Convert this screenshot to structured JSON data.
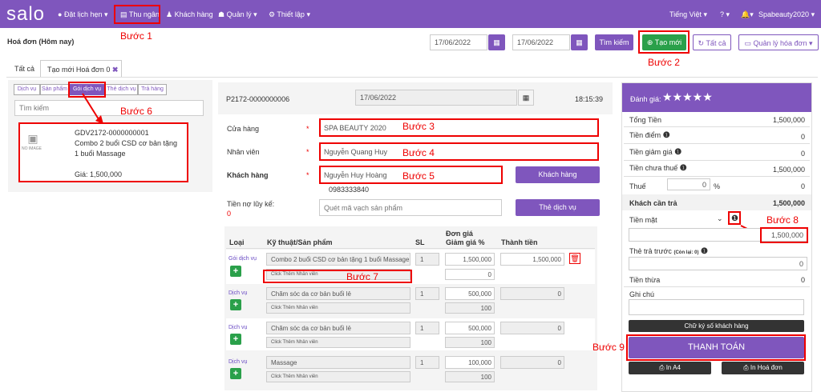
{
  "nav": {
    "logo": "salo",
    "items": [
      "Đặt lịch hẹn",
      "Thu ngân",
      "Khách hàng",
      "Quản lý",
      "Thiết lập"
    ],
    "lang": "Tiếng Việt",
    "user": "Spabeauty2020"
  },
  "header": {
    "title": "Hoá đơn (Hôm nay)",
    "date_from": "17/06/2022",
    "date_to": "17/06/2022",
    "search": "Tìm kiếm",
    "create": "Tạo mới",
    "all": "Tất cả",
    "manage": "Quản lý hóa đơn"
  },
  "tabs": {
    "all": "Tất cả",
    "new": "Tạo mới Hoá đơn 0"
  },
  "left": {
    "tabs": [
      "Dịch vụ",
      "Sản phẩm",
      "Gói dịch vụ",
      "Thẻ dịch vụ",
      "Trả hàng"
    ],
    "search_placeholder": "Tìm kiếm",
    "product": {
      "code": "GDV2172-0000000001",
      "name": "Combo 2 buổi CSD cơ bản tặng 1 buổi Massage",
      "price": "Giá: 1,500,000",
      "noimage": "NO IMAGE"
    }
  },
  "invoice": {
    "code": "P2172-0000000006",
    "date": "17/06/2022",
    "time": "18:15:39",
    "store_label": "Cửa hàng",
    "store": "SPA BEAUTY 2020",
    "staff_label": "Nhân viên",
    "staff": "Nguyễn Quang Huy",
    "customer_label": "Khách hàng",
    "customer": "Nguyễn Huy Hoàng",
    "phone": "0983333840",
    "customer_btn": "Khách hàng",
    "debt_label": "Tiền nợ lũy kế:",
    "debt": "0",
    "barcode_placeholder": "Quét mã vạch sản phẩm",
    "card_btn": "Thẻ dịch vụ",
    "cols": {
      "type": "Loại",
      "item": "Kỹ thuật/Sản phẩm",
      "qty": "SL",
      "price": "Đơn giá",
      "discount": "Giảm giá %",
      "total": "Thành tiền"
    },
    "staff_placeholder": "Click Thêm Nhân viên",
    "rows": [
      {
        "type": "Gói dịch vụ",
        "name": "Combo 2 buổi CSD cơ bản tặng 1 buổi Massage",
        "qty": "1",
        "price": "1,500,000",
        "discount": "0",
        "total": "1,500,000"
      },
      {
        "type": "Dịch vụ",
        "name": "Chăm sóc da cơ bản buổi lẻ",
        "qty": "1",
        "price": "500,000",
        "discount": "100",
        "total": "0"
      },
      {
        "type": "Dịch vụ",
        "name": "Chăm sóc da cơ bản buổi lẻ",
        "qty": "1",
        "price": "500,000",
        "discount": "100",
        "total": "0"
      },
      {
        "type": "Dịch vụ",
        "name": "Massage",
        "qty": "1",
        "price": "100,000",
        "discount": "100",
        "total": "0"
      }
    ]
  },
  "summary": {
    "rating": "Đánh giá:",
    "stars": "★★★★★",
    "total_label": "Tổng Tiền",
    "total": "1,500,000",
    "points_label": "Tiền điểm",
    "points": "0",
    "discount_label": "Tiền giảm giá",
    "discount": "0",
    "pretax_label": "Tiền chưa thuế",
    "pretax": "1,500,000",
    "tax_label": "Thuế",
    "tax_input": "0",
    "tax_unit": "%",
    "tax": "0",
    "due_label": "Khách cần trả",
    "due": "1,500,000",
    "cash_label": "Tiền mặt",
    "cash": "1,500,000",
    "prepaid_label": "Thẻ trả trước",
    "prepaid_note": "(Còn lại: 0)",
    "prepaid": "0",
    "change_label": "Tiền thừa",
    "change": "0",
    "note_label": "Ghi chú",
    "signature": "Chữ ký số khách hàng",
    "pay": "THANH TOÁN",
    "print_a4": "In A4",
    "print_invoice": "In Hoá đơn"
  },
  "steps": [
    "Bước 1",
    "Bước 2",
    "Bước 3",
    "Bước 4",
    "Bước 5",
    "Bước 6",
    "Bước 7",
    "Bước 8",
    "Bước 9"
  ],
  "colors": {
    "brand": "#7f56bd",
    "callout": "#e00000",
    "success": "#2aa04a"
  }
}
